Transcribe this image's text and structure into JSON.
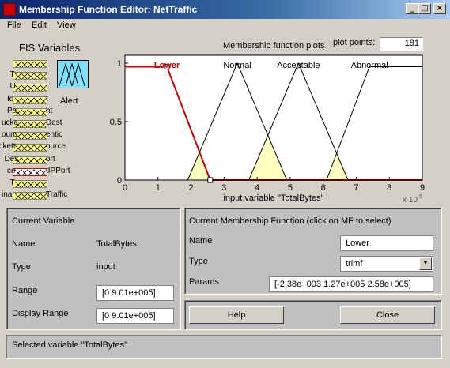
{
  "window": {
    "title": "Membership Function Editor: NetTraffic",
    "minimize": "_",
    "maximize": "□",
    "close": "×"
  },
  "menu": [
    "File",
    "Edit",
    "View"
  ],
  "fis_variables": {
    "title": "FIS Variables",
    "inputs": [
      {
        "label": ""
      },
      {
        "label": "T"
      },
      {
        "label": "U"
      },
      {
        "label": "Id"
      },
      {
        "label": "Pa"
      },
      {
        "label": "ucke"
      },
      {
        "label": "ourc"
      },
      {
        "label": "ckett"
      },
      {
        "label": "Des"
      },
      {
        "label": "ce"
      },
      {
        "label": "T"
      },
      {
        "label": "inal"
      }
    ],
    "input_suffixes": [
      "",
      "",
      "",
      "t",
      "ht",
      "Dest",
      "entic",
      "ource",
      "ort",
      "tIPPort",
      "",
      "Traffic"
    ],
    "selected_index": 9,
    "output": {
      "label": "Alert"
    }
  },
  "plot": {
    "title": "Membership function plots",
    "plot_points_label": "plot points:",
    "plot_points_value": "181",
    "xlabel": "input variable \"TotalBytes\"",
    "exponent_label": "x 10",
    "exponent_power": "5",
    "selected_color": "#c00000",
    "mf_labels": [
      {
        "name": "Lower",
        "selected": true
      },
      {
        "name": "Normal",
        "selected": false
      },
      {
        "name": "Acceptable",
        "selected": false
      },
      {
        "name": "Abnormal",
        "selected": false
      }
    ]
  },
  "chart_data": {
    "type": "line",
    "xlabel": "input variable \"TotalBytes\"",
    "xlim": [
      0,
      9
    ],
    "ylim": [
      0,
      1
    ],
    "x_ticks": [
      "0",
      "1",
      "2",
      "3",
      "4",
      "5",
      "6",
      "7",
      "8",
      "9"
    ],
    "y_ticks": [
      "0",
      "0.5",
      "1"
    ],
    "series": [
      {
        "name": "Lower",
        "points": [
          [
            0,
            0.97
          ],
          [
            1.27,
            0.97
          ],
          [
            2.58,
            0
          ],
          [
            9,
            0
          ]
        ]
      },
      {
        "name": "Normal",
        "points": [
          [
            0,
            0
          ],
          [
            1.9,
            0
          ],
          [
            3.4,
            1
          ],
          [
            4.9,
            0
          ],
          [
            9,
            0
          ]
        ]
      },
      {
        "name": "Acceptable",
        "points": [
          [
            0,
            0
          ],
          [
            3.75,
            0
          ],
          [
            5.25,
            1
          ],
          [
            6.75,
            0
          ],
          [
            9,
            0
          ]
        ]
      },
      {
        "name": "Abnormal",
        "points": [
          [
            0,
            0
          ],
          [
            6.1,
            0
          ],
          [
            7.4,
            0.97
          ],
          [
            9,
            0.97
          ]
        ]
      }
    ]
  },
  "current_variable": {
    "title": "Current Variable",
    "name_label": "Name",
    "name_value": "TotalBytes",
    "type_label": "Type",
    "type_value": "input",
    "range_label": "Range",
    "range_value": "[0 9.01e+005]",
    "display_range_label": "Display Range",
    "display_range_value": "[0 9.01e+005]"
  },
  "current_mf": {
    "title": "Current Membership Function (click on MF to select)",
    "name_label": "Name",
    "name_value": "Lower",
    "type_label": "Type",
    "type_value": "trimf",
    "params_label": "Params",
    "params_value": "[-2.38e+003 1.27e+005 2.58e+005]"
  },
  "buttons": {
    "help": "Help",
    "close": "Close"
  },
  "status": "Selected variable \"TotalBytes\""
}
